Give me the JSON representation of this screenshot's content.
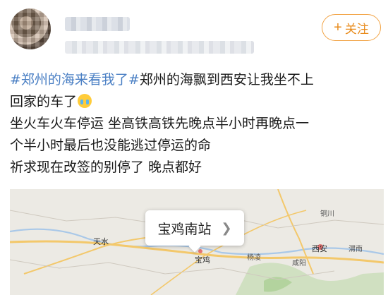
{
  "header": {
    "follow_label": "关注",
    "follow_icon": "plus-icon"
  },
  "post": {
    "tag1": "#郑州的海来看我了#",
    "line1_rest": "郑州的海飘到西安让我坐不上",
    "line2": "回家的车了",
    "line3": "坐火车火车停运 坐高铁高铁先晚点半小时再晚点一",
    "line4": "个半小时最后也没能逃过停运的命",
    "line5": "祈求现在改签的别停了 晚点都好",
    "emoji": "crying-face-emoji"
  },
  "map": {
    "location_name": "宝鸡南站",
    "labels": [
      "天水",
      "宝鸡",
      "西安",
      "咸阳",
      "渭南",
      "铜川",
      "杨凌"
    ],
    "colors": {
      "background": "#eceae4",
      "road": "#f3c86b",
      "river": "#a9c8e8",
      "green": "#b9d7a8"
    }
  },
  "colors": {
    "tag": "#4a7fc4",
    "follow": "#e88a1a",
    "text": "#1a1a1a"
  }
}
